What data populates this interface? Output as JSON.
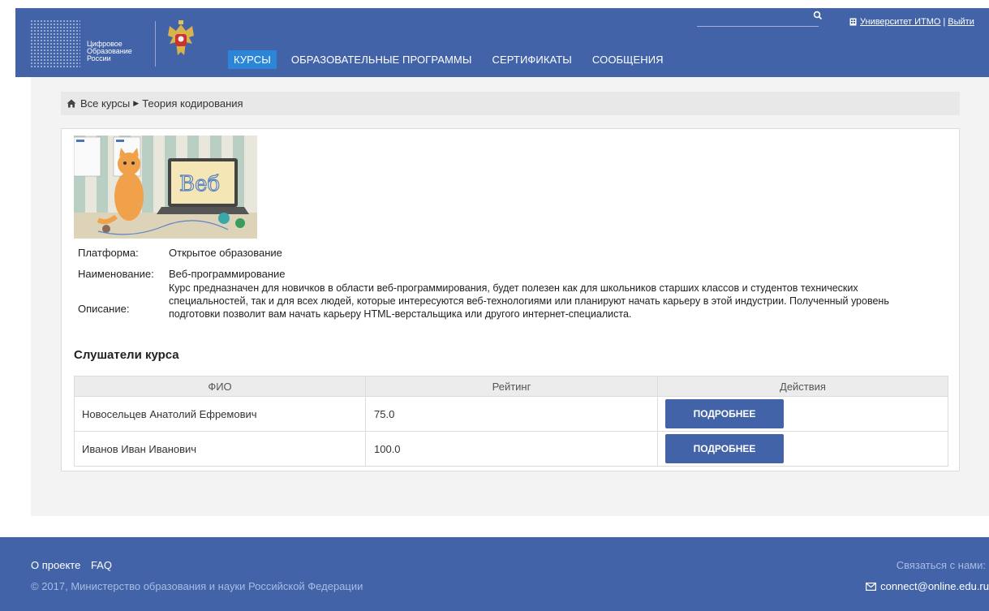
{
  "header": {
    "logo_lines": [
      "Цифровое",
      "Образование",
      "России"
    ],
    "nav": [
      {
        "label": "КУРСЫ",
        "active": true
      },
      {
        "label": "ОБРАЗОВАТЕЛЬНЫЕ ПРОГРАММЫ",
        "active": false
      },
      {
        "label": "СЕРТИФИКАТЫ",
        "active": false
      },
      {
        "label": "СООБЩЕНИЯ",
        "active": false
      }
    ],
    "university_link": "Университет ИТМО",
    "separator": "|",
    "logout_link": "Выйти",
    "accent_color": "#4263a8",
    "active_tab_color": "#2c86d8"
  },
  "breadcrumb": {
    "home": "Все курсы",
    "current": "Теория кодирования"
  },
  "course": {
    "platform_label": "Платформа:",
    "platform_value": "Открытое образование",
    "name_label": "Наименование:",
    "name_value": "Веб-программирование",
    "description_label": "Описание:",
    "description_value": "Курс предназначен для новичков в области веб-программирования, будет полезен как для школьников старших классов и студентов технических специальностей, так и для всех людей, которые интересуются веб-технологиями или планируют начать карьеру в этой индустрии. Полученный уровень подготовки позволит вам начать карьеру HTML-верстальщика или другого интернет-специалиста.",
    "image_text": "Веб"
  },
  "listeners": {
    "title": "Слушатели курса",
    "columns": [
      "ФИО",
      "Рейтинг",
      "Действия"
    ],
    "rows": [
      {
        "name": "Новосельцев Анатолий Ефремович",
        "rating": "75.0",
        "action": "ПОДРОБНЕЕ"
      },
      {
        "name": "Иванов Иван Иванович",
        "rating": "100.0",
        "action": "ПОДРОБНЕЕ"
      }
    ]
  },
  "footer": {
    "about": "О проекте",
    "faq": "FAQ",
    "copyright": "© 2017, Министерство образования и науки Российской Федерации",
    "contact_label": "Связаться с нами:",
    "email": "connect@online.edu.ru"
  }
}
